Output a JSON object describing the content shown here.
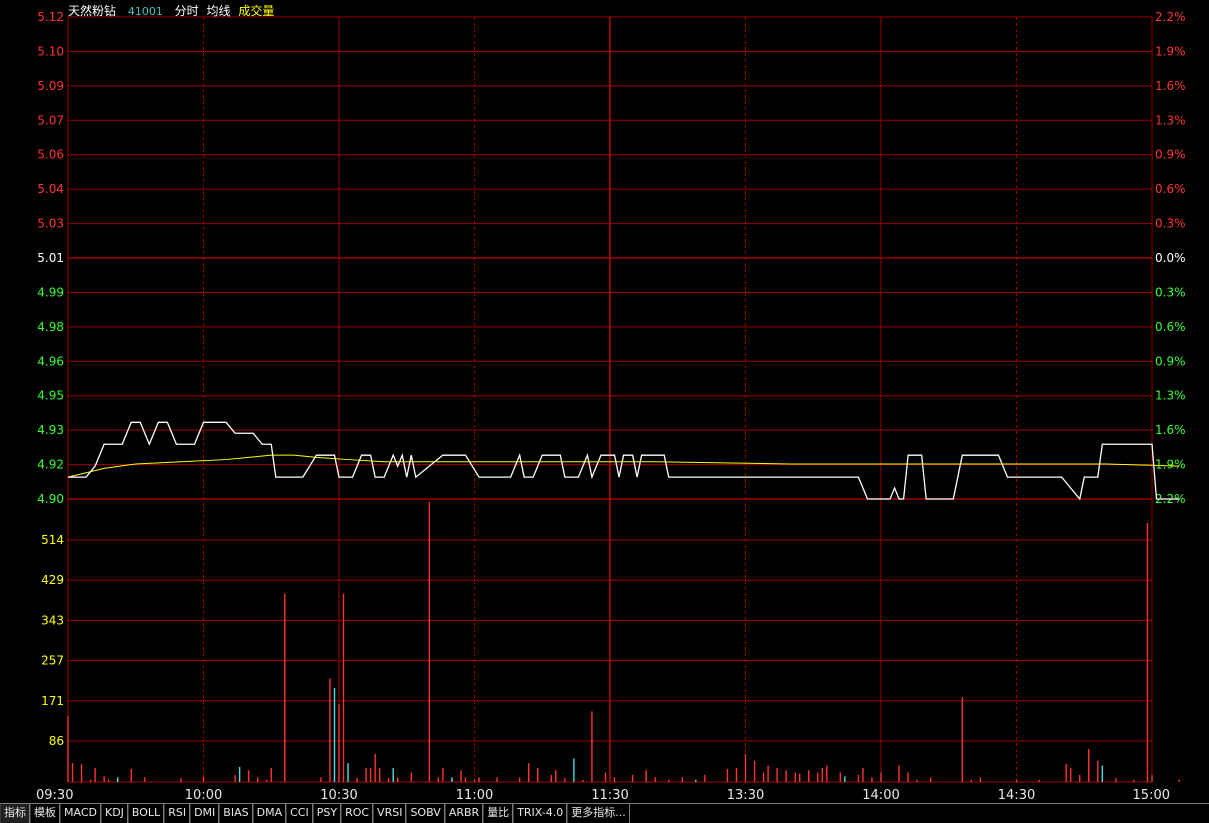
{
  "header": {
    "name": "天然粉钻",
    "code": "41001",
    "mode": "分时",
    "avg_label": "均线",
    "vol_label": "成交量"
  },
  "toolbar": [
    "指标",
    "模板",
    "MACD",
    "KDJ",
    "BOLL",
    "RSI",
    "DMI",
    "BIAS",
    "DMA",
    "CCI",
    "PSY",
    "ROC",
    "VRSI",
    "SOBV",
    "ARBR",
    "量比",
    "TRIX-4.0",
    "更多指标..."
  ],
  "colors": {
    "up": "#ff3232",
    "down": "#33ff33",
    "flat": "#ffffff",
    "grid": "#a00000",
    "price_line": "#ffffff",
    "avg_line": "#ffff00",
    "vol_label": "#ffff00"
  },
  "chart_data": {
    "type": "line",
    "pre_close": 5.01,
    "price_axis_labels": [
      "5.12",
      "5.10",
      "5.09",
      "5.07",
      "5.06",
      "5.04",
      "5.03",
      "5.01",
      "4.99",
      "4.98",
      "4.96",
      "4.95",
      "4.93",
      "4.92",
      "4.90"
    ],
    "percent_axis_labels": [
      "2.2%",
      "1.9%",
      "1.6%",
      "1.3%",
      "0.9%",
      "0.6%",
      "0.3%",
      "0.0%",
      "0.3%",
      "0.6%",
      "0.9%",
      "1.3%",
      "1.6%",
      "1.9%",
      "2.2%"
    ],
    "ylim": [
      4.9,
      5.12
    ],
    "volume_axis_labels": [
      "514",
      "429",
      "343",
      "257",
      "171",
      "86"
    ],
    "volume_ylim": [
      0,
      600
    ],
    "time_labels": [
      "09:30",
      "10:00",
      "10:30",
      "11:00",
      "11:30",
      "13:30",
      "14:00",
      "14:30",
      "15:00"
    ],
    "minutes_total": 240,
    "price": [
      [
        0,
        4.91
      ],
      [
        4,
        4.91
      ],
      [
        6,
        4.915
      ],
      [
        8,
        4.925
      ],
      [
        12,
        4.925
      ],
      [
        14,
        4.935
      ],
      [
        16,
        4.935
      ],
      [
        18,
        4.925
      ],
      [
        20,
        4.935
      ],
      [
        22,
        4.935
      ],
      [
        24,
        4.925
      ],
      [
        28,
        4.925
      ],
      [
        30,
        4.935
      ],
      [
        35,
        4.935
      ],
      [
        37,
        4.93
      ],
      [
        41,
        4.93
      ],
      [
        43,
        4.925
      ],
      [
        45,
        4.925
      ],
      [
        46,
        4.91
      ],
      [
        48,
        4.91
      ],
      [
        52,
        4.91
      ],
      [
        55,
        4.92
      ],
      [
        59,
        4.92
      ],
      [
        60,
        4.91
      ],
      [
        63,
        4.91
      ],
      [
        65,
        4.92
      ],
      [
        67,
        4.92
      ],
      [
        68,
        4.91
      ],
      [
        70,
        4.91
      ],
      [
        72,
        4.92
      ],
      [
        73,
        4.915
      ],
      [
        74,
        4.92
      ],
      [
        75,
        4.91
      ],
      [
        76,
        4.92
      ],
      [
        77,
        4.91
      ],
      [
        83,
        4.92
      ],
      [
        88,
        4.92
      ],
      [
        91,
        4.91
      ],
      [
        98,
        4.91
      ],
      [
        100,
        4.92
      ],
      [
        101,
        4.91
      ],
      [
        103,
        4.91
      ],
      [
        105,
        4.92
      ],
      [
        109,
        4.92
      ],
      [
        110,
        4.91
      ],
      [
        113,
        4.91
      ],
      [
        115,
        4.92
      ],
      [
        116,
        4.91
      ],
      [
        118,
        4.92
      ],
      [
        121,
        4.92
      ],
      [
        122,
        4.91
      ],
      [
        123,
        4.92
      ],
      [
        125,
        4.92
      ],
      [
        126,
        4.91
      ],
      [
        127,
        4.92
      ],
      [
        132,
        4.92
      ],
      [
        133,
        4.91
      ],
      [
        160,
        4.91
      ],
      [
        175,
        4.91
      ],
      [
        177,
        4.9
      ],
      [
        182,
        4.9
      ],
      [
        183,
        4.905
      ],
      [
        184,
        4.9
      ],
      [
        185,
        4.9
      ],
      [
        186,
        4.92
      ],
      [
        189,
        4.92
      ],
      [
        190,
        4.9
      ],
      [
        196,
        4.9
      ],
      [
        198,
        4.92
      ],
      [
        206,
        4.92
      ],
      [
        208,
        4.91
      ],
      [
        220,
        4.91
      ],
      [
        224,
        4.9
      ],
      [
        225,
        4.91
      ],
      [
        228,
        4.91
      ],
      [
        229,
        4.925
      ],
      [
        240,
        4.925
      ],
      [
        241,
        4.9
      ],
      [
        246,
        4.9
      ]
    ],
    "avg": [
      [
        0,
        4.91
      ],
      [
        8,
        4.914
      ],
      [
        15,
        4.916
      ],
      [
        25,
        4.917
      ],
      [
        35,
        4.918
      ],
      [
        40,
        4.919
      ],
      [
        45,
        4.92
      ],
      [
        50,
        4.92
      ],
      [
        55,
        4.919
      ],
      [
        62,
        4.918
      ],
      [
        70,
        4.917
      ],
      [
        78,
        4.917
      ],
      [
        90,
        4.917
      ],
      [
        110,
        4.917
      ],
      [
        130,
        4.917
      ],
      [
        160,
        4.916
      ],
      [
        200,
        4.916
      ],
      [
        230,
        4.916
      ],
      [
        246,
        4.915
      ]
    ],
    "volume": [
      [
        0,
        140
      ],
      [
        1,
        40
      ],
      [
        3,
        38
      ],
      [
        5,
        5
      ],
      [
        6,
        30
      ],
      [
        8,
        12
      ],
      [
        9,
        5
      ],
      [
        11,
        10
      ],
      [
        14,
        28
      ],
      [
        17,
        10
      ],
      [
        25,
        8
      ],
      [
        30,
        12
      ],
      [
        37,
        15
      ],
      [
        38,
        32
      ],
      [
        40,
        25
      ],
      [
        42,
        10
      ],
      [
        44,
        5
      ],
      [
        45,
        30
      ],
      [
        48,
        400
      ],
      [
        56,
        10
      ],
      [
        58,
        220
      ],
      [
        59,
        200
      ],
      [
        60,
        165
      ],
      [
        61,
        400
      ],
      [
        62,
        40
      ],
      [
        64,
        8
      ],
      [
        66,
        30
      ],
      [
        67,
        30
      ],
      [
        68,
        60
      ],
      [
        69,
        30
      ],
      [
        71,
        8
      ],
      [
        72,
        30
      ],
      [
        73,
        10
      ],
      [
        76,
        20
      ],
      [
        80,
        595
      ],
      [
        82,
        10
      ],
      [
        83,
        30
      ],
      [
        85,
        10
      ],
      [
        87,
        25
      ],
      [
        88,
        10
      ],
      [
        90,
        5
      ],
      [
        91,
        10
      ],
      [
        95,
        10
      ],
      [
        100,
        10
      ],
      [
        102,
        40
      ],
      [
        104,
        30
      ],
      [
        107,
        15
      ],
      [
        108,
        25
      ],
      [
        110,
        8
      ],
      [
        112,
        50
      ],
      [
        114,
        5
      ],
      [
        116,
        150
      ],
      [
        119,
        20
      ],
      [
        121,
        10
      ],
      [
        125,
        15
      ],
      [
        128,
        25
      ],
      [
        130,
        10
      ],
      [
        133,
        5
      ],
      [
        136,
        10
      ],
      [
        139,
        5
      ],
      [
        141,
        15
      ],
      [
        146,
        28
      ],
      [
        148,
        30
      ],
      [
        150,
        60
      ],
      [
        152,
        45
      ],
      [
        154,
        20
      ],
      [
        155,
        35
      ],
      [
        157,
        30
      ],
      [
        159,
        25
      ],
      [
        161,
        20
      ],
      [
        162,
        18
      ],
      [
        164,
        25
      ],
      [
        166,
        20
      ],
      [
        167,
        30
      ],
      [
        168,
        35
      ],
      [
        171,
        20
      ],
      [
        172,
        12
      ],
      [
        175,
        15
      ],
      [
        176,
        30
      ],
      [
        178,
        10
      ],
      [
        180,
        20
      ],
      [
        184,
        35
      ],
      [
        186,
        20
      ],
      [
        188,
        5
      ],
      [
        191,
        10
      ],
      [
        198,
        180
      ],
      [
        200,
        5
      ],
      [
        202,
        10
      ],
      [
        210,
        5
      ],
      [
        215,
        5
      ],
      [
        221,
        38
      ],
      [
        222,
        30
      ],
      [
        224,
        15
      ],
      [
        226,
        70
      ],
      [
        228,
        45
      ],
      [
        229,
        35
      ],
      [
        232,
        8
      ],
      [
        236,
        5
      ],
      [
        239,
        550
      ],
      [
        240,
        15
      ],
      [
        246,
        5
      ]
    ],
    "volume_up_color": "#ff3232",
    "volume_down_color": "#40e0e0",
    "volume_down_minutes": [
      11,
      38,
      59,
      62,
      72,
      85,
      101,
      112,
      127,
      139,
      172,
      218,
      229
    ]
  }
}
